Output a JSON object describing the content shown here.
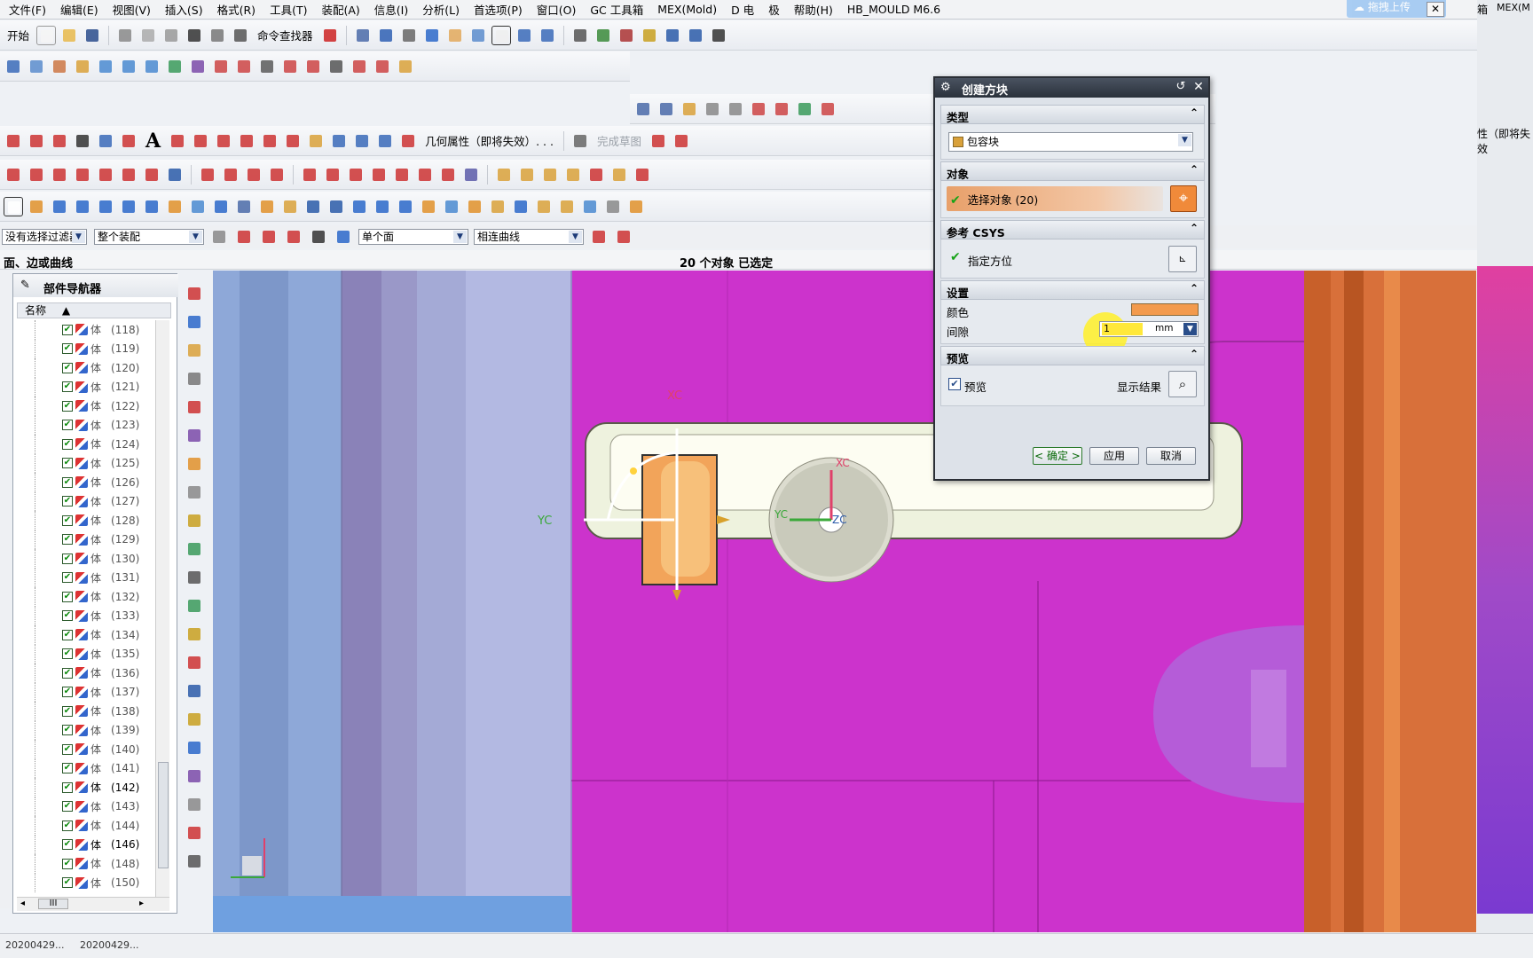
{
  "menubar": {
    "items": [
      "文件(F)",
      "编辑(E)",
      "视图(V)",
      "插入(S)",
      "格式(R)",
      "工具(T)",
      "装配(A)",
      "信息(I)",
      "分析(L)",
      "首选项(P)",
      "窗口(O)",
      "GC 工具箱",
      "MEX(Mold)",
      "D 电",
      "极",
      "帮助(H)",
      "HB_MOULD M6.6"
    ],
    "upload_label": "拖拽上传"
  },
  "toolbar1": {
    "start_label": "开始",
    "cmd_finder_label": "命令查找器"
  },
  "toolbar4": {
    "geom_attr_label": "几何属性（即将失效）. . .",
    "finish_sketch_label": "完成草图"
  },
  "filterbar": {
    "type_filter": "没有选择过滤器",
    "scope": "整个装配",
    "face_rule": "单个面",
    "curve_rule": "相连曲线"
  },
  "status": {
    "left_text": "面、边或曲线",
    "selection_text": "20 个对象 已选定"
  },
  "navigator": {
    "title": "部件导航器",
    "column_name": "名称",
    "rows": [
      {
        "label": "体",
        "num": "(118)",
        "dark": false
      },
      {
        "label": "体",
        "num": "(119)",
        "dark": false
      },
      {
        "label": "体",
        "num": "(120)",
        "dark": false
      },
      {
        "label": "体",
        "num": "(121)",
        "dark": false
      },
      {
        "label": "体",
        "num": "(122)",
        "dark": false
      },
      {
        "label": "体",
        "num": "(123)",
        "dark": false
      },
      {
        "label": "体",
        "num": "(124)",
        "dark": false
      },
      {
        "label": "体",
        "num": "(125)",
        "dark": false
      },
      {
        "label": "体",
        "num": "(126)",
        "dark": false
      },
      {
        "label": "体",
        "num": "(127)",
        "dark": false
      },
      {
        "label": "体",
        "num": "(128)",
        "dark": false
      },
      {
        "label": "体",
        "num": "(129)",
        "dark": false
      },
      {
        "label": "体",
        "num": "(130)",
        "dark": false
      },
      {
        "label": "体",
        "num": "(131)",
        "dark": false
      },
      {
        "label": "体",
        "num": "(132)",
        "dark": false
      },
      {
        "label": "体",
        "num": "(133)",
        "dark": false
      },
      {
        "label": "体",
        "num": "(134)",
        "dark": false
      },
      {
        "label": "体",
        "num": "(135)",
        "dark": false
      },
      {
        "label": "体",
        "num": "(136)",
        "dark": false
      },
      {
        "label": "体",
        "num": "(137)",
        "dark": false
      },
      {
        "label": "体",
        "num": "(138)",
        "dark": false
      },
      {
        "label": "体",
        "num": "(139)",
        "dark": false
      },
      {
        "label": "体",
        "num": "(140)",
        "dark": false
      },
      {
        "label": "体",
        "num": "(141)",
        "dark": false
      },
      {
        "label": "体",
        "num": "(142)",
        "dark": true
      },
      {
        "label": "体",
        "num": "(143)",
        "dark": false
      },
      {
        "label": "体",
        "num": "(144)",
        "dark": false
      },
      {
        "label": "体",
        "num": "(146)",
        "dark": true
      },
      {
        "label": "体",
        "num": "(148)",
        "dark": false
      },
      {
        "label": "体",
        "num": "(150)",
        "dark": false
      }
    ],
    "hscroll_label": "III"
  },
  "viewport": {
    "axis_xc": "XC",
    "axis_yc": "YC",
    "axis_zc": "ZC",
    "csys_xc": "XC",
    "csys_yc": "YC"
  },
  "dialog": {
    "title": "创建方块",
    "section_type": "类型",
    "type_value": "包容块",
    "section_object": "对象",
    "select_object": "选择对象 (20)",
    "section_csys": "参考 CSYS",
    "specify_orientation": "指定方位",
    "section_settings": "设置",
    "color_label": "颜色",
    "color_value": "#f39a4c",
    "gap_label": "间隙",
    "gap_value": "1",
    "gap_unit": "mm",
    "section_preview": "预览",
    "preview_check_label": "预览",
    "show_result_label": "显示结果",
    "ok_label": "< 确定 >",
    "apply_label": "应用",
    "cancel_label": "取消"
  },
  "rightpanel": {
    "label1": "箱",
    "label2": "MEX(M",
    "label3": "性（即将失效"
  },
  "taskbar": {
    "item1": "20200429...",
    "item2": "20200429..."
  },
  "colors": {
    "magenta": "#cc33cc",
    "orange": "#d8703a",
    "accent": "#f39a4c"
  }
}
